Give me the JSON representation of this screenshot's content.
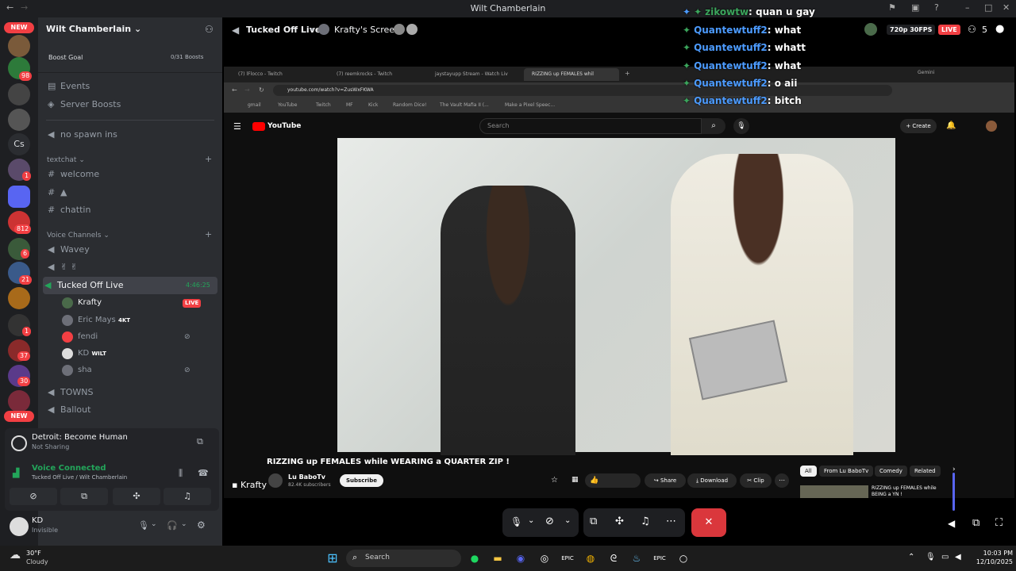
{
  "window": {
    "title": "Wilt Chamberlain"
  },
  "servers": {
    "new_top": "NEW",
    "new_bottom": "NEW",
    "badges": [
      "98",
      "1",
      "812",
      "6",
      "21",
      "1",
      "37",
      "30"
    ],
    "cs_label": "Cs"
  },
  "sidebar": {
    "server_name": "Wilt Chamberlain",
    "boost_goal": "Boost Goal",
    "boost_count": "0/31 Boosts",
    "events": "Events",
    "server_boosts": "Server Boosts",
    "no_spawn": "no spawn ins",
    "textchat": "textchat",
    "welcome": "welcome",
    "chattin": "chattin",
    "voice_channels": "Voice Channels",
    "wavey": "Wavey",
    "hands": "✌ ✌",
    "tucked": "Tucked Off Live",
    "timer": "4:46:25",
    "users": [
      {
        "name": "Krafty",
        "tag": "LIVE"
      },
      {
        "name": "Eric Mays",
        "tag": "4KT"
      },
      {
        "name": "fendi",
        "tag": ""
      },
      {
        "name": "KD",
        "tag": "WILT"
      },
      {
        "name": "sha",
        "tag": ""
      }
    ],
    "towns": "TOWNS",
    "ballout": "Ballout",
    "activity_title": "Detroit: Become Human",
    "activity_sub": "Not Sharing",
    "voice_connected": "Voice Connected",
    "voice_sub": "Tucked Off Live / Wilt Chamberlain",
    "me_name": "KD",
    "me_status": "Invisible"
  },
  "stage": {
    "channel": "Tucked Off Live",
    "screen": "Krafty's Screen",
    "quality": "720p 30FPS",
    "live": "LIVE",
    "viewers": "5",
    "streamer_label": "Krafty"
  },
  "chat": [
    {
      "user": "zikowtw",
      "msg": ": quan u gay",
      "first": true
    },
    {
      "user": "Quantewtuff2",
      "msg": ": what"
    },
    {
      "user": "Quantewtuff2",
      "msg": ": whatt"
    },
    {
      "user": "Quantewtuff2",
      "msg": ": what"
    },
    {
      "user": "Quantewtuff2",
      "msg": ": o aii"
    },
    {
      "user": "Quantewtuff2",
      "msg": ": bitch"
    }
  ],
  "browser": {
    "tabs": [
      "(7) lFlocco - Twitch",
      "(7) reemkrocks - Twitch",
      "jaystayupp Stream - Watch Liv",
      "RIZZING up FEMALES whil"
    ],
    "gemini": "Gemini",
    "url": "youtube.com/watch?v=ZusWxFKWA",
    "bookmarks": [
      "gmail",
      "YouTube",
      "Twitch",
      "MF",
      "Kick",
      "Random Dice!",
      "The Vault Mafia II (...",
      "Make a Pixel Speec..."
    ],
    "yt_logo": "YouTube",
    "yt_search": "Search",
    "yt_create": "Create",
    "video_title": "RIZZING up FEMALES while WEARING a QUARTER ZIP !",
    "channel": "Lu BaboTv",
    "subs": "82.4K subscribers",
    "subscribe": "Subscribe",
    "share": "Share",
    "download": "Download",
    "clip": "Clip",
    "chips": [
      "All",
      "From Lu BaboTv",
      "Comedy",
      "Related"
    ],
    "side_title": "RIZZING up FEMALES while BEING a YN !"
  },
  "taskbar": {
    "temp": "30°F",
    "weather": "Cloudy",
    "search": "Search",
    "time": "10:03 PM",
    "date": "12/10/2025"
  },
  "colors": {
    "accent": "#5865f2",
    "live": "#f23f43",
    "green": "#23a55a"
  }
}
